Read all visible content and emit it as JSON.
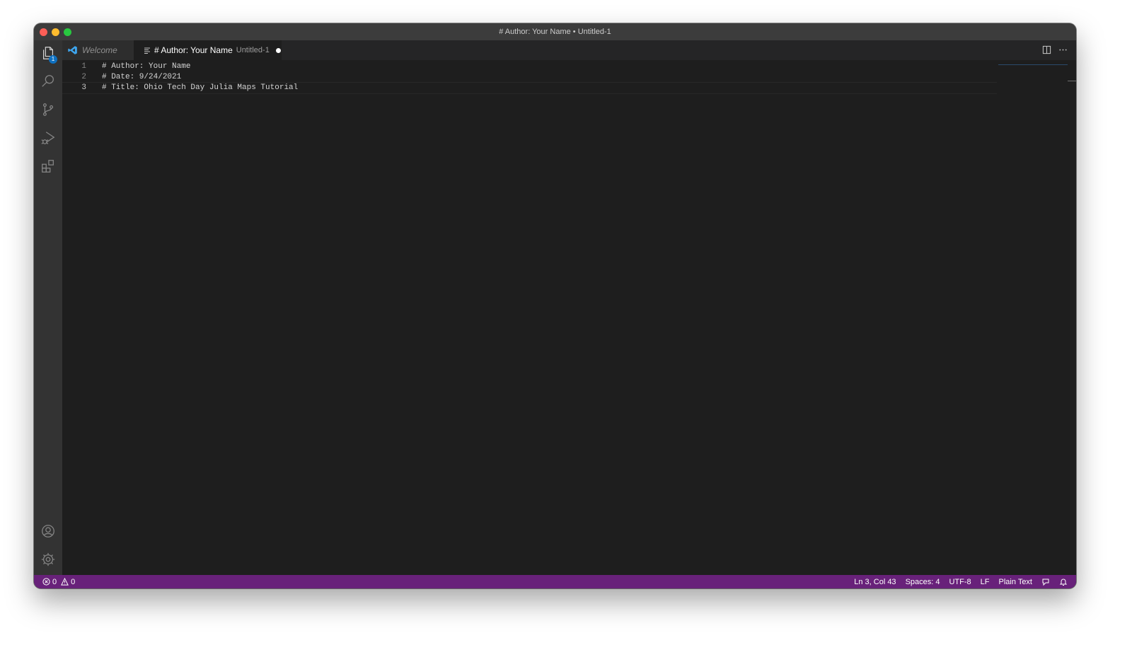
{
  "window": {
    "title": "# Author: Your Name • Untitled-1"
  },
  "activity_bar": {
    "explorer_badge": "1",
    "items": [
      "files-icon",
      "search-icon",
      "source-control-icon",
      "run-debug-icon",
      "extensions-icon",
      "account-icon",
      "gear-icon"
    ]
  },
  "tabs": [
    {
      "label": "Welcome",
      "icon": "vscode-logo-icon"
    },
    {
      "label": "# Author: Your Name",
      "description": "Untitled-1",
      "icon": "text-file-icon",
      "dirty": true
    }
  ],
  "editor": {
    "lines": [
      {
        "number": "1",
        "text": "# Author: Your Name"
      },
      {
        "number": "2",
        "text": "# Date: 9/24/2021"
      },
      {
        "number": "3",
        "text": "# Title: Ohio Tech Day Julia Maps Tutorial"
      }
    ]
  },
  "status_bar": {
    "errors": "0",
    "warnings": "0",
    "cursor": "Ln 3, Col 43",
    "indent": "Spaces: 4",
    "encoding": "UTF-8",
    "eol": "LF",
    "language": "Plain Text",
    "color": "#68217a"
  },
  "colors": {
    "editor_bg": "#1e1e1e",
    "activity_bar": "#333333",
    "tab_bar": "#252526",
    "title_bar": "#3c3c3c",
    "accent": "#0e70c0"
  }
}
